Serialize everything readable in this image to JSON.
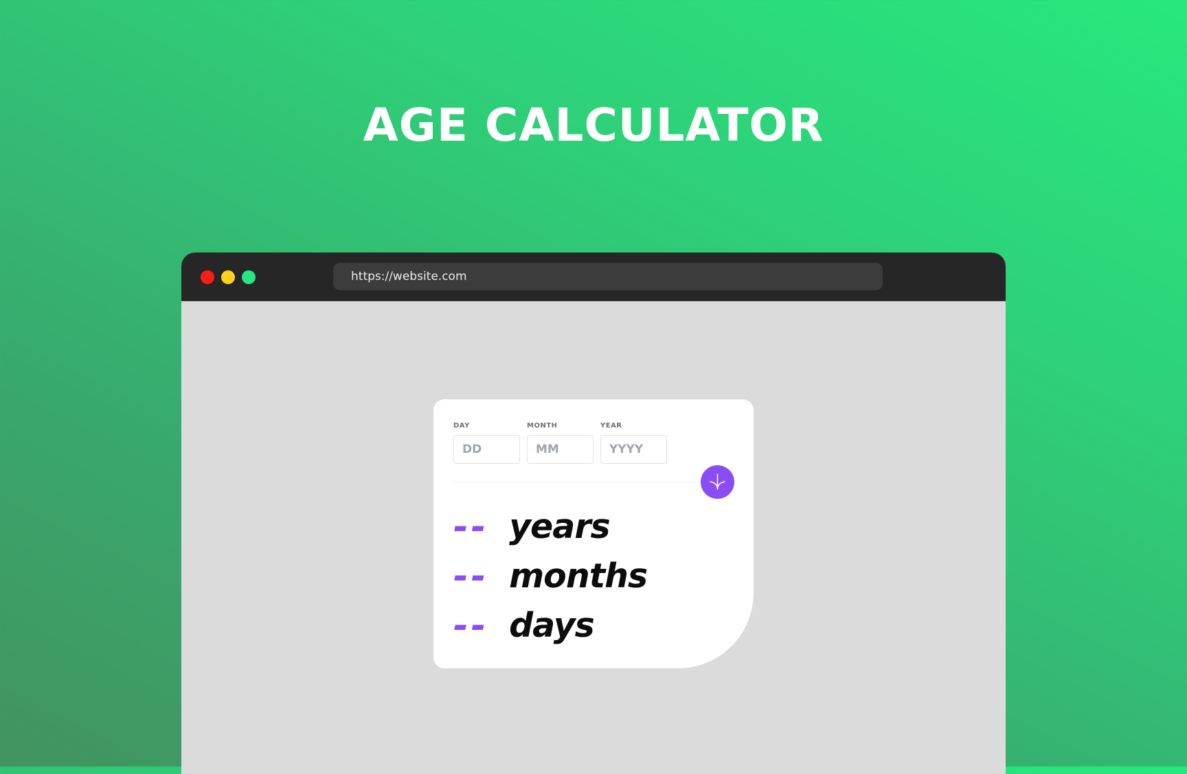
{
  "hero": {
    "title": "AGE CALCULATOR"
  },
  "browser": {
    "url": "https://website.com",
    "window_controls": {
      "close_color": "#ff1c14",
      "minimize_color": "#ffd11a",
      "maximize_color": "#27e87e"
    }
  },
  "form": {
    "day": {
      "label": "DAY",
      "placeholder": "DD",
      "value": ""
    },
    "month": {
      "label": "MONTH",
      "placeholder": "MM",
      "value": ""
    },
    "year": {
      "label": "YEAR",
      "placeholder": "YYYY",
      "value": ""
    },
    "submit_icon": "arrow-down-icon"
  },
  "results": {
    "years": {
      "value": "--",
      "unit": "years"
    },
    "months": {
      "value": "--",
      "unit": "months"
    },
    "days": {
      "value": "--",
      "unit": "days"
    }
  },
  "colors": {
    "accent": "#8a4df5",
    "background_start": "#27e87e",
    "background_end": "#42935f",
    "card": "#ffffff",
    "browser_content": "#dbdbdb",
    "browser_bar": "#262626"
  }
}
